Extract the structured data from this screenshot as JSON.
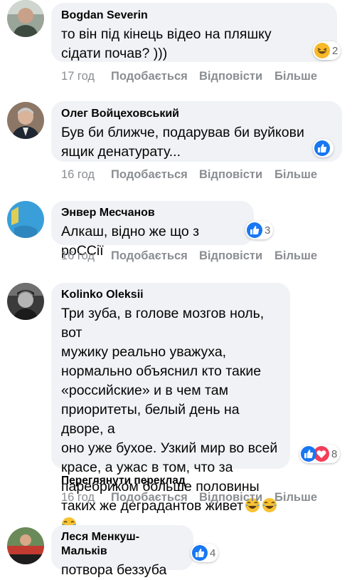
{
  "comments": [
    {
      "author": "Bogdan Severin",
      "text_lines": [
        "то він під кінець відео на пляшку",
        "сідати почав? )))"
      ],
      "reaction_count": "2",
      "time": "17 год",
      "like_label": "Подобається",
      "reply_label": "Відповісти",
      "more_label": "Більше",
      "reaction_icons": [
        "haha-icon"
      ]
    },
    {
      "author": "Олег Войцеховський",
      "text_lines": [
        "Був би ближче, подарував би вуйкови",
        "ящик денатурату..."
      ],
      "reaction_count": "",
      "time": "16 год",
      "like_label": "Подобається",
      "reply_label": "Відповісти",
      "more_label": "Більше",
      "reaction_icons": [
        "like-icon"
      ]
    },
    {
      "author": "Энвер Месчанов",
      "text_lines": [
        "Алкаш, відно же що з роССії"
      ],
      "reaction_count": "3",
      "time": "16 год",
      "like_label": "Подобається",
      "reply_label": "Відповісти",
      "more_label": "Більше",
      "reaction_icons": [
        "like-icon"
      ]
    },
    {
      "author": "Kolinko Oleksii",
      "text_lines": [
        "Три зуба, в голове мозгов ноль, вот",
        "мужику реально уважуха,",
        "нормально объяснил кто такие",
        "«российские» и в чем там",
        "приоритеты, белый день на дворе, а",
        "оно уже бухое. Узкий мир во всей",
        "красе, а ужас в том, что за",
        "паребриком больше половины",
        "таких же деградантов живет"
      ],
      "trailing_emojis": [
        "tears-of-joy-emoji",
        "tears-of-joy-emoji",
        "tears-of-joy-emoji"
      ],
      "reaction_count": "8",
      "translate_label": "Переглянути переклад",
      "time": "16 год",
      "like_label": "Подобається",
      "reply_label": "Відповісти",
      "more_label": "Більше",
      "reaction_icons": [
        "like-icon",
        "love-icon"
      ]
    },
    {
      "author": "Леся Менкуш-Мальків",
      "text_lines": [
        "потвора беззуба"
      ],
      "reaction_count": "4",
      "reaction_icons": [
        "like-icon"
      ]
    }
  ],
  "colors": {
    "bubble": "#f0f2f5",
    "action_text": "#8a8d91",
    "like_blue": "#1877f2",
    "love_red": "#f33e58",
    "haha_yellow": "#f7b928"
  }
}
